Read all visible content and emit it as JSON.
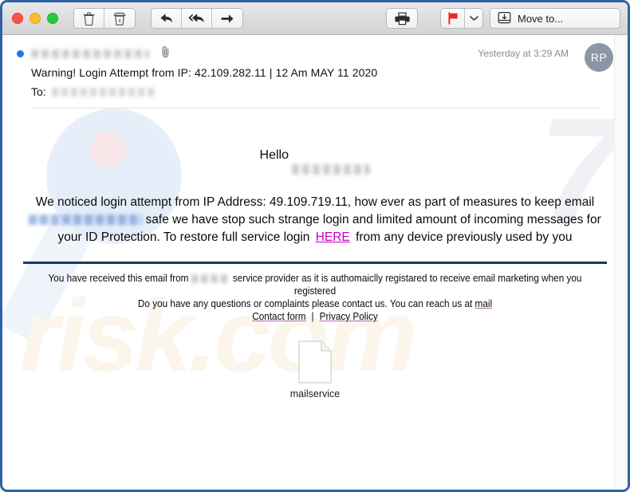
{
  "window": {
    "frame_color": "#2f62a4"
  },
  "toolbar": {
    "traffic_lights": [
      {
        "name": "close",
        "color": "#f9534f"
      },
      {
        "name": "minimize",
        "color": "#fbbd2e"
      },
      {
        "name": "zoom",
        "color": "#29c83f"
      }
    ],
    "buttons": [
      {
        "name": "delete",
        "icon": "trash-icon"
      },
      {
        "name": "junk",
        "icon": "junk-trash-icon"
      },
      {
        "name": "reply",
        "icon": "reply-arrow-icon"
      },
      {
        "name": "reply-all",
        "icon": "reply-all-arrow-icon"
      },
      {
        "name": "forward",
        "icon": "forward-arrow-icon"
      }
    ],
    "print_icon": "printer-icon",
    "flag_icon": "red-flag-icon",
    "flag_color": "#ee2222",
    "flag_chevron_icon": "chevron-down-icon",
    "move_to_icon": "move-to-tray-icon",
    "move_to_label": "Move to..."
  },
  "message_header": {
    "unread": true,
    "unread_dot_color": "#1a7af0",
    "sender_name": "",
    "attachment_icon": "paperclip-icon",
    "subject": "Warning! Login Attempt from IP: 42.109.282.11    |    12  Am MAY 11 2020",
    "to_label": "To:",
    "to_value": "",
    "date": "Yesterday at 3:29 AM",
    "avatar_initials": "RP"
  },
  "message_body": {
    "greeting": "Hello",
    "greeting_name": "",
    "paragraph_part1": "We noticed login attempt from IP Address: 49.109.719.11, how ever as part of measures to keep email",
    "paragraph_part2": "safe we  have  stop such strange login and limited amount of incoming messages for your ID Protection. To restore full service login",
    "link_label": "HERE",
    "link_color": "#c400c4",
    "paragraph_part3": "from any device previously used by you",
    "divider_color": "#173a66"
  },
  "footer": {
    "line1_part1": "You have received this email from",
    "line1_part2": "service provider as  it is authomaiclly registared to receive email marketing when you registered",
    "line2": "Do you have any questions or complaints please contact us. You can reach us at",
    "mail_link": "mail",
    "contact_form_link": "Contact form",
    "separator": "|",
    "privacy_policy_link": "Privacy Policy"
  },
  "attachment": {
    "icon": "blank-document-icon",
    "filename": "mailservice"
  },
  "watermark": {
    "text": "risk.com",
    "color": "#fcf5ec"
  }
}
